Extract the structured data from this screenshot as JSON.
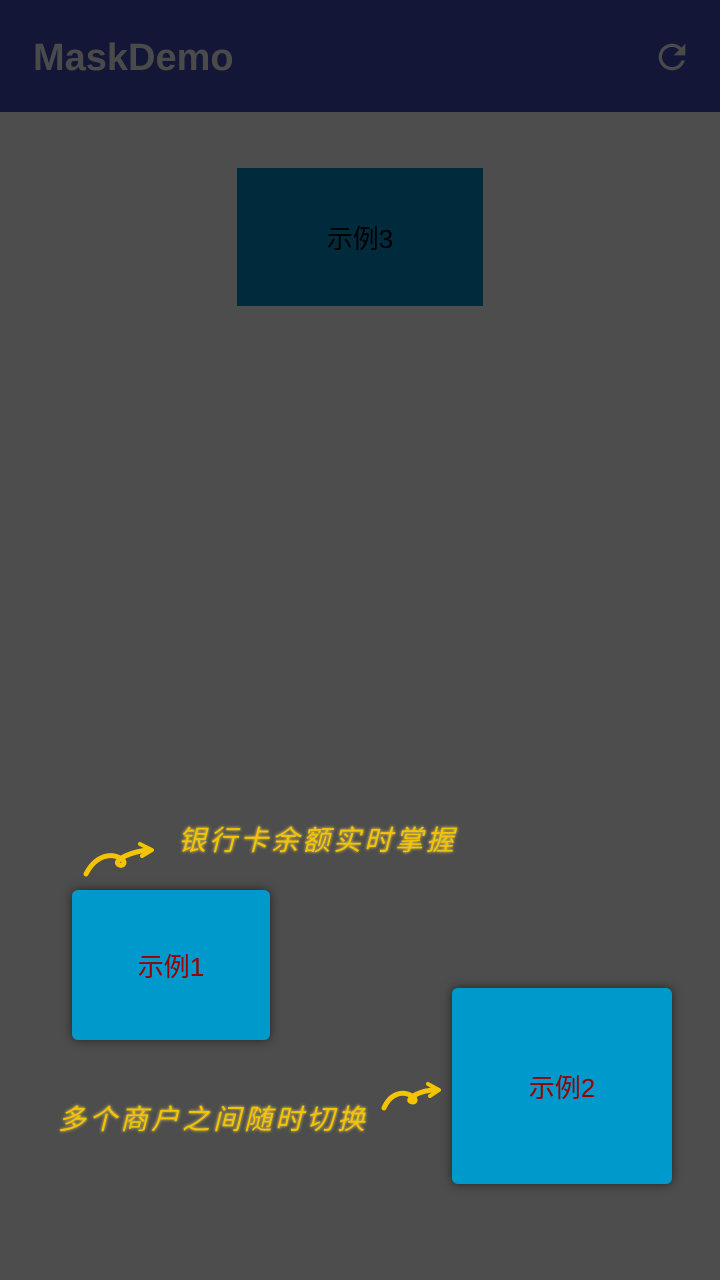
{
  "app_bar": {
    "title": "MaskDemo",
    "action_icon": "refresh-icon",
    "background": "#131636"
  },
  "content": {
    "background": "#4d4d4d",
    "example3": {
      "label": "示例3",
      "background": "#002b3d"
    },
    "example1": {
      "label": "示例1",
      "background": "#0099cc",
      "text_color": "#990000"
    },
    "example2": {
      "label": "示例2",
      "background": "#0099cc",
      "text_color": "#990000"
    },
    "hint1": {
      "text": "银行卡余额实时掌握",
      "color": "#f5c400",
      "icon": "curved-arrow-icon"
    },
    "hint2": {
      "text": "多个商户之间随时切换",
      "color": "#f5c400",
      "icon": "curved-arrow-icon"
    }
  }
}
